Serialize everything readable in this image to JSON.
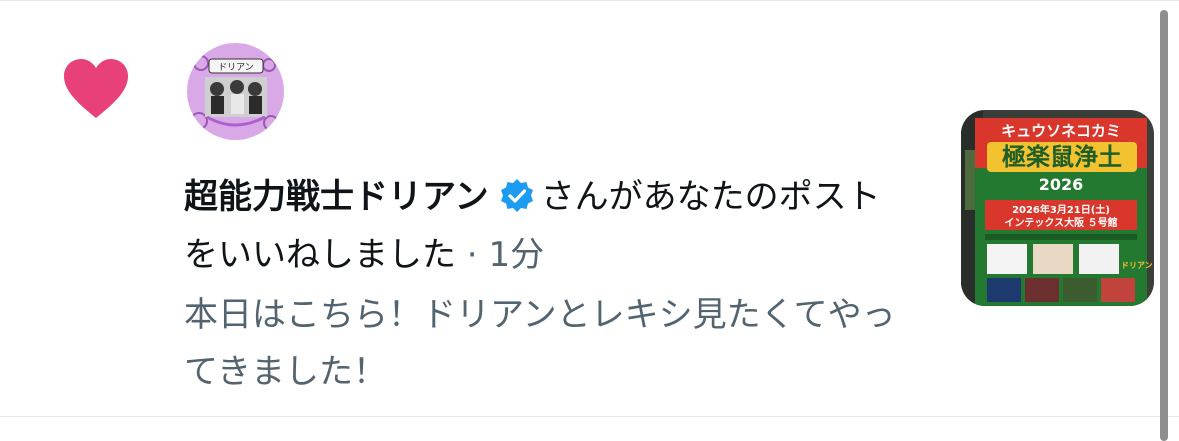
{
  "notification": {
    "type_icon": "heart-icon",
    "user_name": "超能力戦士ドリアン",
    "verified_icon": "verified-badge-icon",
    "action_text": "さんがあなたのポストをいいねしました",
    "separator": " · ",
    "time": "1分",
    "post_text": "本日はこちら！ドリアンとレキシ見たくてやってきました！"
  },
  "thumbnail": {
    "brand_text": "キュウソネコカミ",
    "event_title": "極楽鼠浄土",
    "year": "2026",
    "date": "2026年3月21日(土)",
    "venue": "インテックス大阪 ５号館",
    "act_label": "ドリアン"
  },
  "avatar": {
    "name_text": "ドリアン"
  },
  "colors": {
    "heart": "#e8417a",
    "verified": "#1d9bf0",
    "name": "#0f1419",
    "secondary": "#536471",
    "divider": "#e6e8ea",
    "scrollbar": "#8e8e8e"
  }
}
